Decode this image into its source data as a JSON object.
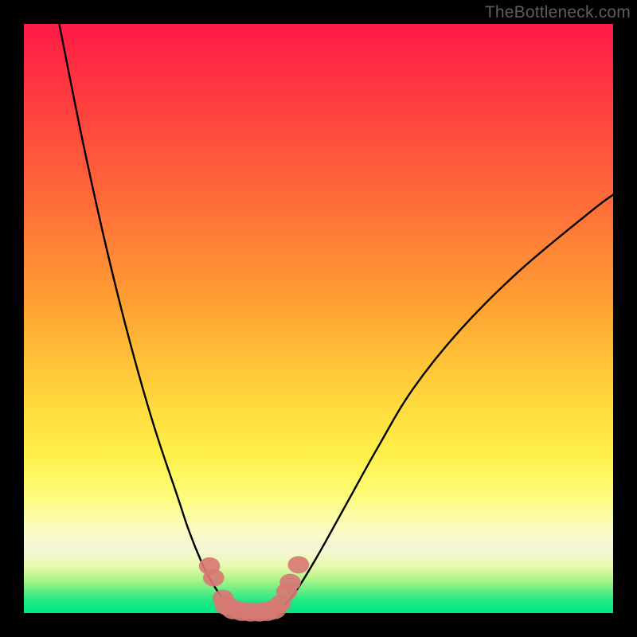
{
  "attribution": "TheBottleneck.com",
  "colors": {
    "gradient_top": "#ff1b47",
    "gradient_mid1": "#ff6b39",
    "gradient_mid2": "#ffd23a",
    "gradient_mid3": "#fdfd7a",
    "gradient_bottom": "#00e884",
    "curve_stroke": "#000000",
    "marker_fill": "#d77a74",
    "frame": "#000000"
  },
  "chart_data": {
    "type": "line",
    "title": "",
    "xlabel": "",
    "ylabel": "",
    "xlim": [
      0,
      100
    ],
    "ylim": [
      0,
      100
    ],
    "series": [
      {
        "name": "left-branch",
        "x": [
          6,
          10,
          14,
          18,
          22,
          26,
          28,
          30,
          31.5,
          33,
          34.5,
          36
        ],
        "y": [
          100,
          80,
          62,
          46,
          32,
          20,
          14,
          9,
          6,
          3.5,
          1.6,
          0.5
        ]
      },
      {
        "name": "right-branch",
        "x": [
          43,
          45,
          47,
          50,
          55,
          60,
          66,
          74,
          84,
          96,
          100
        ],
        "y": [
          0.5,
          2.2,
          5,
          10,
          19,
          28,
          38,
          48,
          58,
          68,
          71
        ]
      },
      {
        "name": "valley-floor",
        "x": [
          34.5,
          36,
          38,
          40,
          42,
          43
        ],
        "y": [
          0.8,
          0.3,
          0.2,
          0.2,
          0.3,
          0.5
        ]
      }
    ],
    "markers": [
      {
        "x": 31.5,
        "y": 8.0,
        "r": 1.8
      },
      {
        "x": 32.2,
        "y": 6.0,
        "r": 1.8
      },
      {
        "x": 33.8,
        "y": 2.5,
        "r": 1.8
      },
      {
        "x": 34.4,
        "y": 1.3,
        "r": 2.0
      },
      {
        "x": 35.5,
        "y": 0.6,
        "r": 2.0
      },
      {
        "x": 37.0,
        "y": 0.3,
        "r": 2.0
      },
      {
        "x": 38.5,
        "y": 0.2,
        "r": 2.0
      },
      {
        "x": 40.0,
        "y": 0.2,
        "r": 2.0
      },
      {
        "x": 41.3,
        "y": 0.3,
        "r": 2.0
      },
      {
        "x": 42.5,
        "y": 0.6,
        "r": 2.0
      },
      {
        "x": 43.5,
        "y": 1.6,
        "r": 1.8
      },
      {
        "x": 44.6,
        "y": 3.6,
        "r": 1.8
      },
      {
        "x": 45.2,
        "y": 5.2,
        "r": 1.8
      },
      {
        "x": 46.6,
        "y": 8.2,
        "r": 1.8
      }
    ]
  }
}
